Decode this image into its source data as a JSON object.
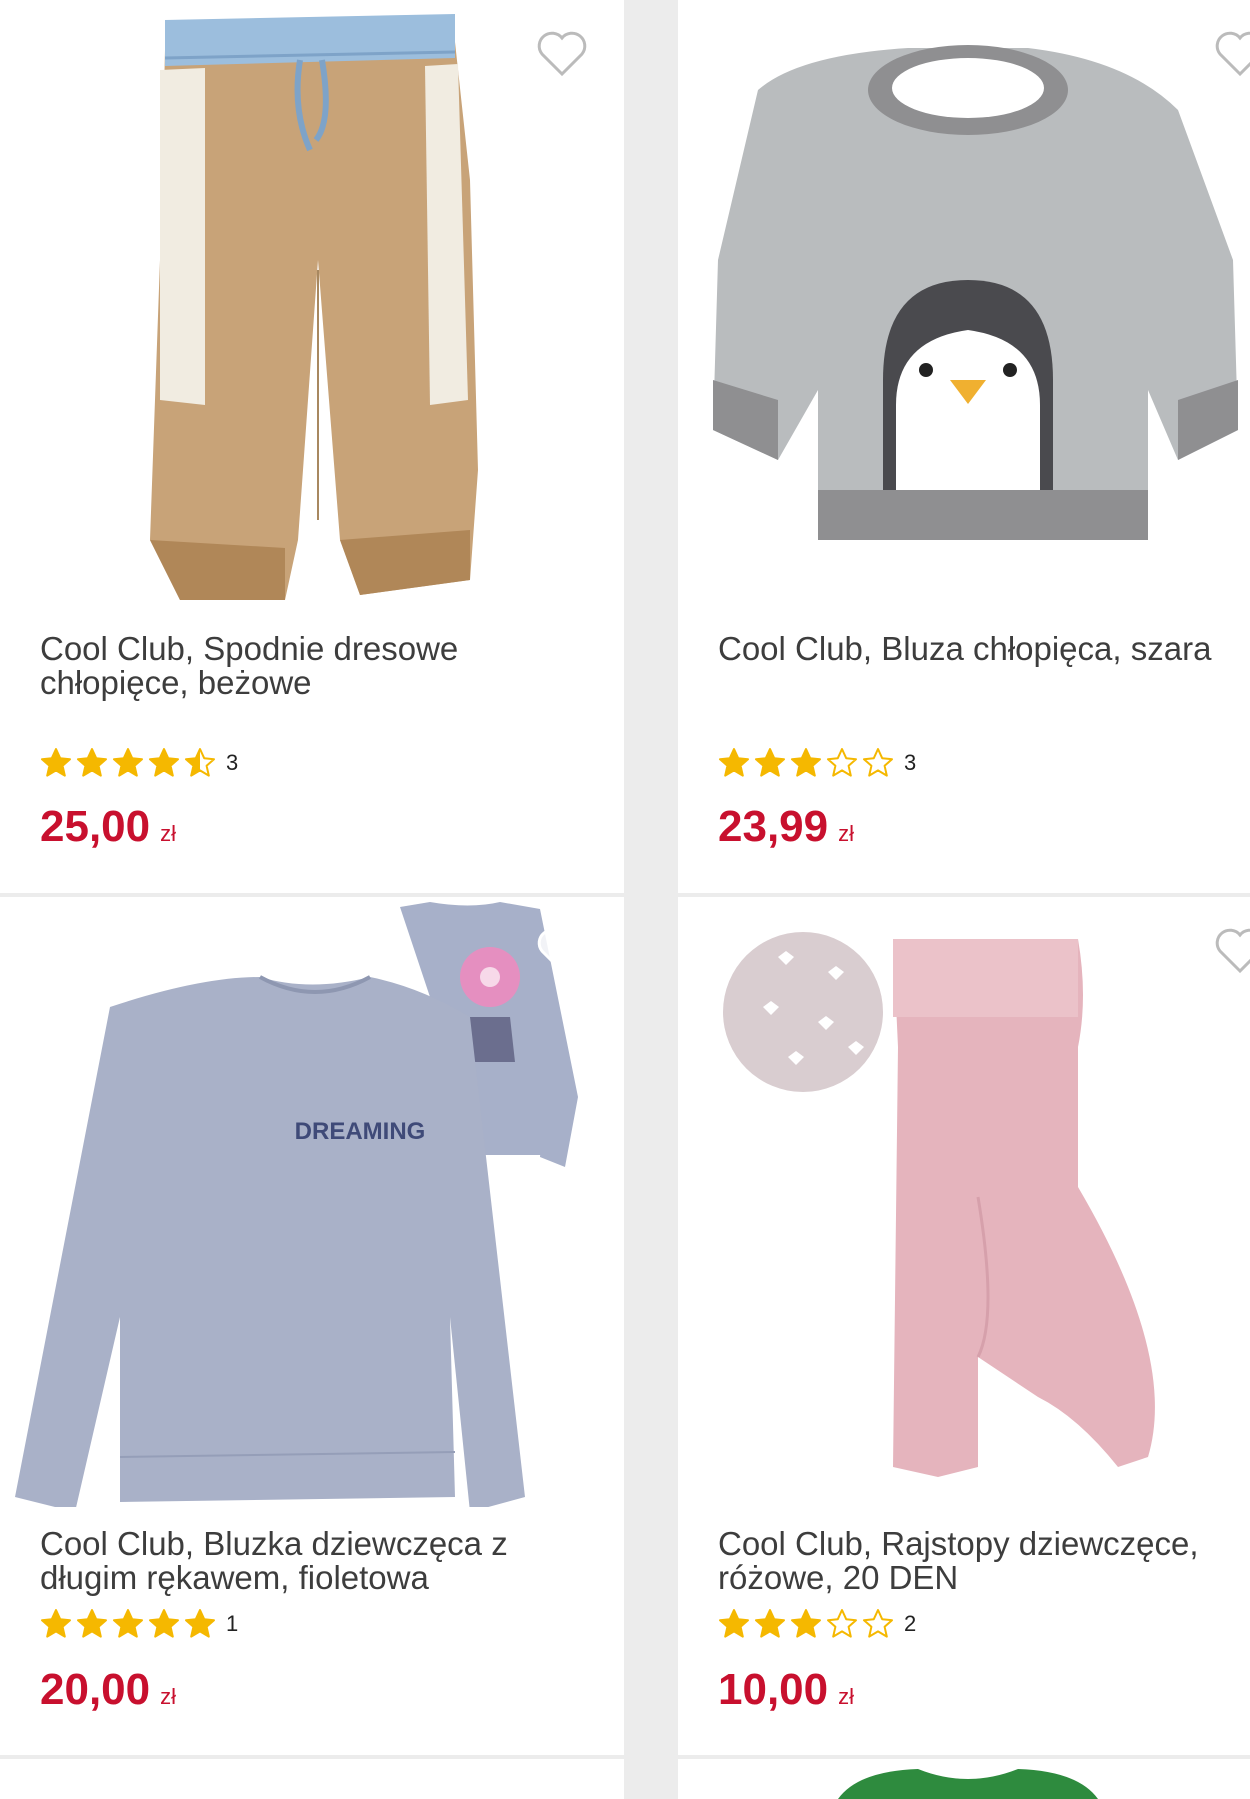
{
  "products": [
    {
      "title": "Cool Club, Spodnie dresowe chłopięce, beżowe",
      "rating": 4.5,
      "rating_count": "3",
      "price": "25,00",
      "currency": "zł",
      "image_icon": "jogger-pants-icon"
    },
    {
      "title": "Cool Club, Bluza chłopięca, szara",
      "rating": 3,
      "rating_count": "3",
      "price": "23,99",
      "currency": "zł",
      "image_icon": "penguin-sweatshirt-icon"
    },
    {
      "title": "Cool Club, Bluzka dziewczęca z długim rękawem, fioletowa",
      "rating": 5,
      "rating_count": "1",
      "price": "20,00",
      "currency": "zł",
      "image_icon": "long-sleeve-top-icon",
      "print_text": "DREAMING"
    },
    {
      "title": "Cool Club, Rajstopy dziewczęce, różowe, 20 DEN",
      "rating": 3,
      "rating_count": "2",
      "price": "10,00",
      "currency": "zł",
      "image_icon": "tights-icon"
    }
  ],
  "colors": {
    "price": "#c8102e",
    "star": "#f5b800",
    "background": "#ececec"
  }
}
